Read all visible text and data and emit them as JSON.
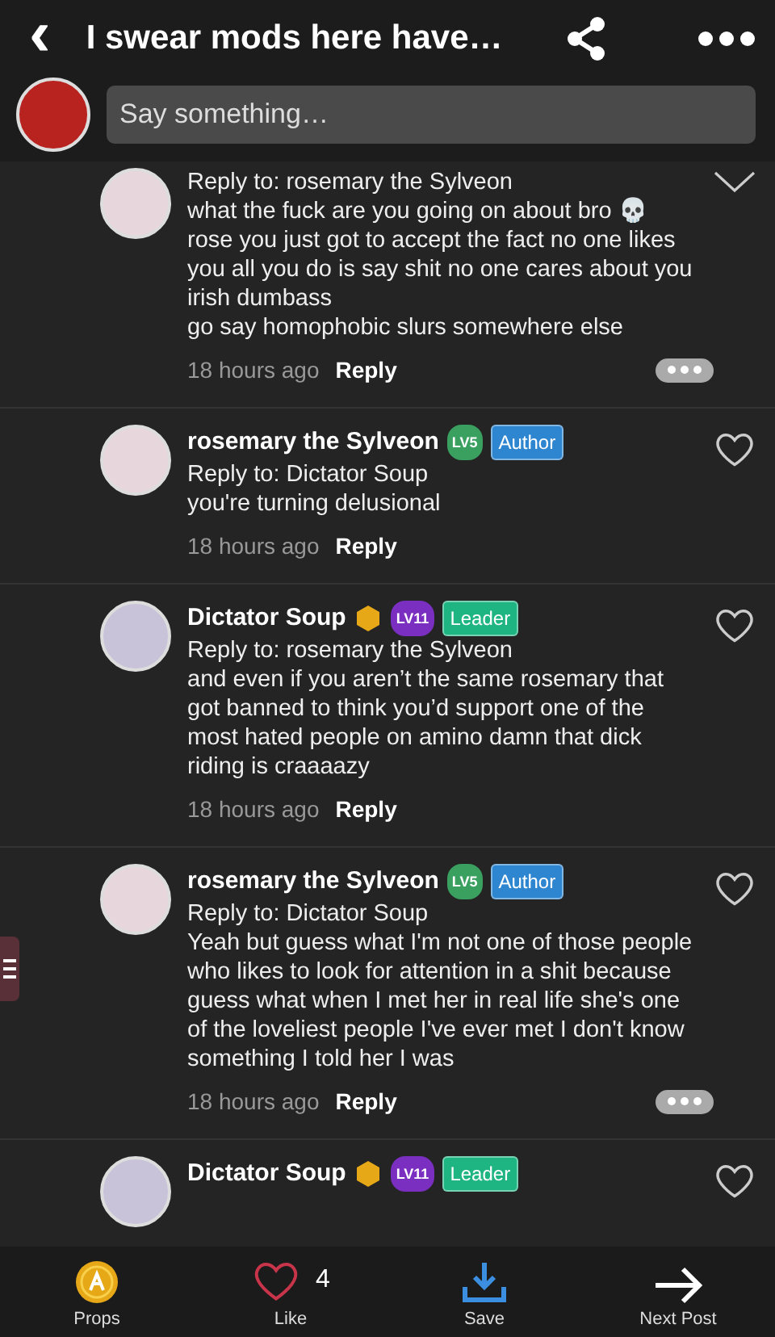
{
  "header": {
    "title": "I swear mods here have…",
    "back": "‹"
  },
  "composer": {
    "placeholder": "Say something…"
  },
  "comments": [
    {
      "kind": "collapsible",
      "reply_to": "Reply to: rosemary the Sylveon",
      "body": "what the fuck are you going on about bro 💀\nrose you just got to accept the fact no one likes you all you do is say shit no one cares about you irish dumbass\ngo say homophobic slurs somewhere else",
      "time": "18 hours ago",
      "reply": "Reply",
      "more": true
    },
    {
      "kind": "likeable",
      "name": "rosemary the Sylveon",
      "badges": [
        {
          "kind": "level",
          "label": "LV5",
          "color": "#3aa060"
        },
        {
          "kind": "tag",
          "label": "Author",
          "color": "#2f86d0"
        }
      ],
      "reply_to": "Reply to: Dictator Soup",
      "body": " you're turning delusional",
      "time": "18 hours ago",
      "reply": "Reply",
      "more": false
    },
    {
      "kind": "likeable",
      "name": "Dictator Soup",
      "badges": [
        {
          "kind": "coin"
        },
        {
          "kind": "level",
          "label": "LV11",
          "color": "#7a2fc0"
        },
        {
          "kind": "tag",
          "label": "Leader",
          "color": "#1fb582"
        }
      ],
      "reply_to": "Reply to: rosemary the Sylveon",
      "body": "and even if you aren’t the same rosemary that got banned to think you’d support one of the most hated people on amino damn that dick riding is craaaazy",
      "time": "18 hours ago",
      "reply": "Reply",
      "more": false
    },
    {
      "kind": "likeable",
      "name": "rosemary the Sylveon",
      "badges": [
        {
          "kind": "level",
          "label": "LV5",
          "color": "#3aa060"
        },
        {
          "kind": "tag",
          "label": "Author",
          "color": "#2f86d0"
        }
      ],
      "reply_to": "Reply to: Dictator Soup",
      "body": "Yeah but guess what I'm not one of those people who likes to look for attention in a shit because guess what when I met her in real life she's one of the loveliest people I've ever met I don't know something I told her I was",
      "time": "18 hours ago",
      "reply": "Reply",
      "more": true
    },
    {
      "kind": "likeable",
      "name": "Dictator Soup",
      "badges": [
        {
          "kind": "coin"
        },
        {
          "kind": "level",
          "label": "LV11",
          "color": "#7a2fc0"
        },
        {
          "kind": "tag",
          "label": "Leader",
          "color": "#1fb582"
        }
      ]
    }
  ],
  "bottom_bar": [
    {
      "kind": "props",
      "label": "Props"
    },
    {
      "kind": "like",
      "label": "Like",
      "count": "4"
    },
    {
      "kind": "save",
      "label": "Save"
    },
    {
      "kind": "next",
      "label": "Next Post"
    }
  ]
}
